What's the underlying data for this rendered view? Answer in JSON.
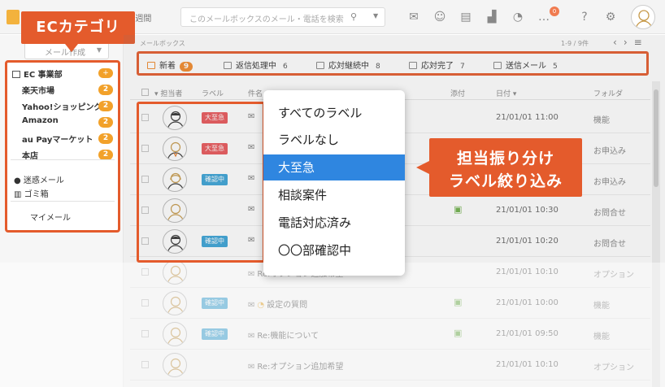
{
  "topbar": {
    "period": "過去2週間",
    "search_placeholder": "このメールボックスのメール・電話を検索",
    "icons": [
      "mail-icon",
      "smile-icon",
      "document-icon",
      "chart-icon",
      "chat-icon",
      "more-icon",
      "help-icon",
      "gear-icon"
    ]
  },
  "sidebar": {
    "compose_label": "メール作成",
    "callout": "ECカテゴリ",
    "category_title": "EC 事業部",
    "category_add": "+",
    "categories": [
      {
        "name": "楽天市場",
        "count": "2"
      },
      {
        "name": "Yahoo!ショッピング",
        "count": "2"
      },
      {
        "name": "Amazon",
        "count": "2"
      },
      {
        "name": "au Payマーケット",
        "count": "2"
      },
      {
        "name": "本店",
        "count": "2"
      }
    ],
    "spam": "迷惑メール",
    "trash": "ゴミ箱",
    "mymail": "マイメール"
  },
  "main": {
    "breadcrumb": "メールボックス",
    "pager": "1-9 / 9件",
    "tabs": [
      {
        "label": "新着",
        "count": "9"
      },
      {
        "label": "返信処理中",
        "count": "6"
      },
      {
        "label": "応対継続中",
        "count": "8"
      },
      {
        "label": "応対完了",
        "count": "7"
      },
      {
        "label": "送信メール",
        "count": "5"
      }
    ],
    "columns": {
      "assignee": "担当者",
      "label": "ラベル",
      "subject": "件名",
      "attach": "添付",
      "date": "日付",
      "folder": "フォルダ"
    },
    "rows": [
      {
        "label": "大至急",
        "subject": "",
        "date": "21/01/01 11:00",
        "folder": "機能",
        "attach": false
      },
      {
        "label": "大至急",
        "subject": "",
        "date": "",
        "folder": "お申込み",
        "attach": false
      },
      {
        "label": "確認中",
        "subject": "",
        "date": "",
        "folder": "お申込み",
        "attach": false
      },
      {
        "label": "",
        "subject": "",
        "date": "21/01/01 10:30",
        "folder": "お問合せ",
        "attach": true
      },
      {
        "label": "確認中",
        "subject": "",
        "date": "21/01/01 10:20",
        "folder": "お問合せ",
        "attach": false
      },
      {
        "label": "",
        "subject": "Re:オプション追加希望",
        "date": "21/01/01 10:10",
        "folder": "オプション",
        "attach": false
      },
      {
        "label": "確認中",
        "subject": "設定の質問",
        "date": "21/01/01 10:00",
        "folder": "機能",
        "attach": true
      },
      {
        "label": "確認中",
        "subject": "Re:機能について",
        "date": "21/01/01 09:50",
        "folder": "機能",
        "attach": true
      },
      {
        "label": "",
        "subject": "Re:オプション追加希望",
        "date": "21/01/01 10:10",
        "folder": "オプション",
        "attach": false
      }
    ]
  },
  "dropdown": {
    "items": [
      "すべてのラベル",
      "ラベルなし",
      "大至急",
      "相談案件",
      "電話対応済み",
      "〇〇部確認中"
    ],
    "active_index": 2
  },
  "callout_right": {
    "line1": "担当振り分け",
    "line2": "ラベル絞り込み"
  },
  "colors": {
    "accent": "#e45b2c",
    "badge": "#f2a12a",
    "label_red": "#e9575a",
    "label_blue": "#3ba3d7",
    "dropdown_active": "#2f86e0"
  }
}
